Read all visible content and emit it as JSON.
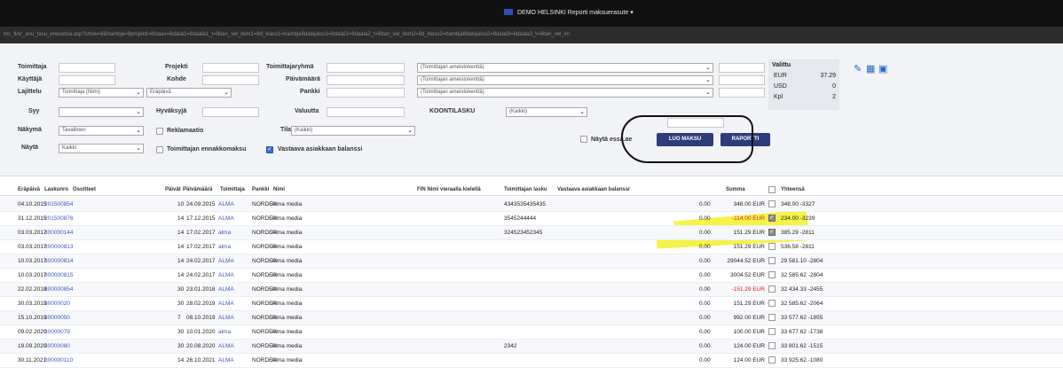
{
  "window": {
    "title": "DEMO HELSINKI Reporti maksuerasute ▾",
    "url": "ms_tl/sr_anu_tasu_enesetoa.asp?show=8&hambja=8projekti=8staas=8dalai1=8daala1_t=8itan_vel_item1=8d_klass1=hambja8dalajaisu1=8dalai2=8daala2_t=8itan_vel_item2=8d_klass2=hambja8dalajaisu2=8dalai3=8daala3_t=8itan_vel_im"
  },
  "filters": {
    "toimittaja": "Toimittaja",
    "kayttaja": "Käyttäjä",
    "lajitelu": "Lajittelu",
    "lajitelu_value": "Toimittaja (Nimi)",
    "lajitelu_value2": "Eräpäivä",
    "syy": "Syy",
    "nakyma": "Näkymä",
    "nakyma_value": "Tavallinen",
    "nayta": "Näytä",
    "nayta_value": "Kaikki",
    "projekti": "Projekti",
    "kohde": "Kohde",
    "hyvaksyja": "Hyväksyjä",
    "raklamaatio": "Reklamaatio",
    "toimittajan_ennakkomaksu": "Toimittajan ennakkomaksu",
    "toimittajaryhma": "Toimittajaryhmä",
    "paivamaara": "Päivämäärä",
    "pankki": "Pankki",
    "valuutta": "Valuutta",
    "tila": "Tila",
    "tila_value": "(Kaikki)",
    "vastaava_asiakkaan_balanssi": "Vastaava asiakkaan balanssi",
    "koontilasku": "KOONTILASKU",
    "koontilasku_value": "(Kaikki)",
    "select1": "(Toimittajan ameistokenttä)",
    "select2": "(Toimittajan ameistokenttä)",
    "select3": "(Toimittajan ameistokenttä)",
    "nayta_essa": "Näytä essa.ae",
    "luo_maksu": "LUO MAKSU",
    "raportti": "RAPORTTI"
  },
  "valittu": {
    "header": "Valittu",
    "rows": [
      {
        "k": "EUR",
        "v": "37.29"
      },
      {
        "k": "USD",
        "v": "0"
      },
      {
        "k": "Kpl",
        "v": "2"
      }
    ]
  },
  "table": {
    "headers": {
      "erapaiva": "Eräpäivä",
      "laskunro": "Laskunro",
      "osoitteet": "Osoitteet",
      "paivat": "Päivät",
      "paivamaara": "Päivämäärä",
      "toimittaja": "Toimittaja",
      "pankki": "Pankki",
      "nimi": "Nimi",
      "fin": "FIN Nimi vieraalla kielellä",
      "toimittajan_lasku": "Toimittajan lasku",
      "vastaava": "Vastaava asiakkaan balanssi",
      "summa": "Summa",
      "yhteensa": "Yhteensä"
    },
    "rows": [
      {
        "erapaiva": "04.10.2015",
        "laskunro": "201500854",
        "paivat": "10",
        "pvm": "24.09.2015",
        "toim": "ALMA",
        "pankki": "NORDEA",
        "nimi": "Alma media",
        "lasku": "4343535435435",
        "bal": "0.00",
        "summa": "348.00 EUR",
        "neg": false,
        "checked": false,
        "yht": "348.00 -3327"
      },
      {
        "erapaiva": "31.12.2015",
        "laskunro": "201500876",
        "paivat": "14",
        "pvm": "17.12.2015",
        "toim": "ALMA",
        "pankki": "NORDEA",
        "nimi": "Alma media",
        "lasku": "3545244444",
        "bal": "0.00",
        "summa": "-114.00 EUR",
        "neg": true,
        "checked": true,
        "yht": "234.00 -3239"
      },
      {
        "erapaiva": "03.03.2017",
        "laskunro": "300000144",
        "paivat": "14",
        "pvm": "17.02.2017",
        "toim": "alma",
        "pankki": "NORDEA",
        "nimi": "Alma media",
        "lasku": "324523452345",
        "bal": "0.00",
        "summa": "151.29 EUR",
        "neg": false,
        "checked": true,
        "yht": "385.29 -2811"
      },
      {
        "erapaiva": "03.03.2017",
        "laskunro": "300000813",
        "paivat": "14",
        "pvm": "17.02.2017",
        "toim": "alma",
        "pankki": "NORDEA",
        "nimi": "Alma media",
        "lasku": "",
        "bal": "0.00",
        "summa": "151.29 EUR",
        "neg": false,
        "checked": false,
        "yht": "536.58 -2811"
      },
      {
        "erapaiva": "10.03.2017",
        "laskunro": "300000814",
        "paivat": "14",
        "pvm": "24.02.2017",
        "toim": "ALMA",
        "pankki": "NORDEA",
        "nimi": "Alma media",
        "lasku": "",
        "bal": "0.00",
        "summa": "29044.52 EUR",
        "neg": false,
        "checked": false,
        "yht": "29 581.10 -2804"
      },
      {
        "erapaiva": "10.03.2017",
        "laskunro": "300000815",
        "paivat": "14",
        "pvm": "24.02.2017",
        "toim": "ALMA",
        "pankki": "NORDEA",
        "nimi": "Alma media",
        "lasku": "",
        "bal": "0.00",
        "summa": "3004.52 EUR",
        "neg": false,
        "checked": false,
        "yht": "32 585.62 -2804"
      },
      {
        "erapaiva": "22.02.2018",
        "laskunro": "300000854",
        "paivat": "30",
        "pvm": "23.01.2018",
        "toim": "ALMA",
        "pankki": "NORDEA",
        "nimi": "Alma media",
        "lasku": "",
        "bal": "0.00",
        "summa": "-151.29 EUR",
        "neg": true,
        "checked": false,
        "yht": "32 434.33 -2455"
      },
      {
        "erapaiva": "30.03.2019",
        "laskunro": "30000020",
        "paivat": "30",
        "pvm": "28.02.2019",
        "toim": "ALMA",
        "pankki": "NORDEA",
        "nimi": "Alma media",
        "lasku": "",
        "bal": "0.00",
        "summa": "151.29 EUR",
        "neg": false,
        "checked": false,
        "yht": "32 585.62 -2064"
      },
      {
        "erapaiva": "15.10.2019",
        "laskunro": "30000050",
        "paivat": "7",
        "pvm": "08.10.2019",
        "toim": "ALMA",
        "pankki": "NORDEA",
        "nimi": "Alma media",
        "lasku": "",
        "bal": "0.00",
        "summa": "992.00 EUR",
        "neg": false,
        "checked": false,
        "yht": "33 577.62 -1855"
      },
      {
        "erapaiva": "09.02.2020",
        "laskunro": "30000079",
        "paivat": "30",
        "pvm": "10.01.2020",
        "toim": "alma",
        "pankki": "NORDEA",
        "nimi": "Alma media",
        "lasku": "",
        "bal": "0.00",
        "summa": "100.00 EUR",
        "neg": false,
        "checked": false,
        "yht": "33 677.62 -1738"
      },
      {
        "erapaiva": "19.09.2020",
        "laskunro": "30000080",
        "paivat": "30",
        "pvm": "20.08.2020",
        "toim": "ALMA",
        "pankki": "NORDEA",
        "nimi": "Alma media",
        "lasku": "2342",
        "bal": "0.00",
        "summa": "124.00 EUR",
        "neg": false,
        "checked": false,
        "yht": "33 801.62 -1515"
      },
      {
        "erapaiva": "30.11.2021",
        "laskunro": "300000110",
        "paivat": "14",
        "pvm": "26.10.2021",
        "toim": "ALMA",
        "pankki": "NORDEA",
        "nimi": "Alma media",
        "lasku": "",
        "bal": "0.00",
        "summa": "124.00 EUR",
        "neg": false,
        "checked": false,
        "yht": "33 925.62 -1080"
      }
    ]
  },
  "colors": {
    "accent": "#2f3c7a",
    "link": "#3b59c4",
    "negative": "#dd2222",
    "highlight": "#f2ef1a"
  },
  "icons": [
    "wrench-icon",
    "spreadsheet-icon",
    "excel-icon",
    "eu-flag-icon",
    "checkbox-icon"
  ]
}
